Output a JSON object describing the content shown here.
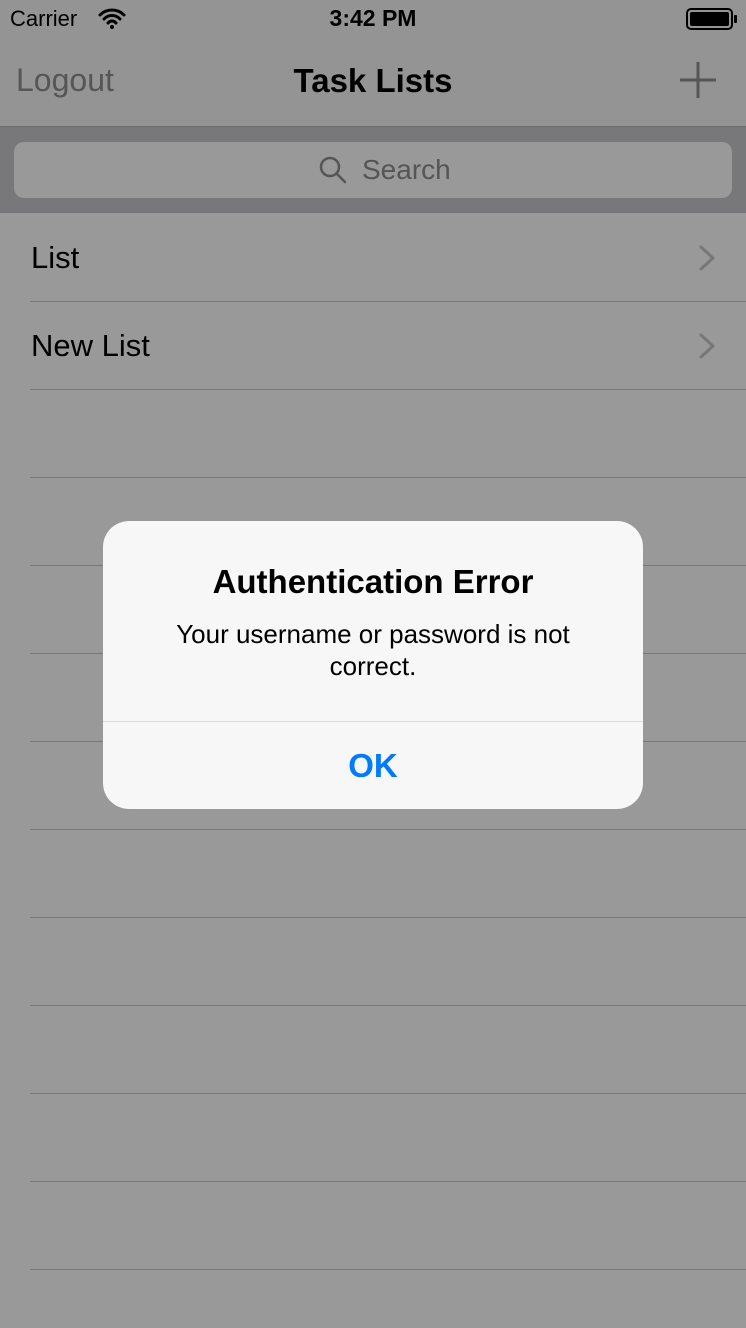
{
  "status_bar": {
    "carrier": "Carrier",
    "time": "3:42 PM",
    "wifi_icon": "wifi-icon",
    "battery_icon": "battery-icon"
  },
  "nav": {
    "left_button": "Logout",
    "title": "Task Lists",
    "right_icon": "plus-icon"
  },
  "search": {
    "placeholder": "Search",
    "value": ""
  },
  "lists": [
    {
      "label": "List"
    },
    {
      "label": "New List"
    }
  ],
  "alert": {
    "title": "Authentication Error",
    "message": "Your username or password is not correct.",
    "button": "OK"
  },
  "colors": {
    "accent": "#007aff",
    "nav_inactive": "#8f8f8f",
    "search_bar_bg": "#c9c9ce",
    "separator": "#c8c7cc"
  }
}
